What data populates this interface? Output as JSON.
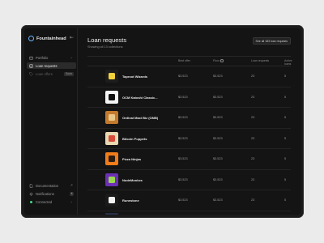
{
  "app": {
    "brand": "Fountainhead"
  },
  "sidebar": {
    "top_items": [
      {
        "label": "Portfolio",
        "icon": "portfolio-icon"
      },
      {
        "label": "Loan requests",
        "icon": "loan-requests-icon",
        "active": true
      },
      {
        "label": "Loan offers",
        "icon": "tag-icon",
        "badge": "Soon",
        "disabled": true
      }
    ],
    "bottom_items": [
      {
        "label": "Documentation",
        "icon": "document-icon"
      },
      {
        "label": "Notifications",
        "icon": "bell-icon",
        "badge": "4"
      },
      {
        "label": "Connected",
        "icon": "status-dot"
      }
    ]
  },
  "main": {
    "title": "Loan requests",
    "subtitle": "Showing all 13 collections",
    "see_all_label": "See all 183 loan requests",
    "columns": [
      "Best offer",
      "Floor",
      "Loan requests",
      "Active loans"
    ],
    "rows": [
      {
        "name": "Taproot Wizards",
        "best_offer": "$3.523",
        "floor": "$3.523",
        "loan_requests": "23",
        "active_loans": "5",
        "thumb_bg": "#1d1d1d",
        "thumb_accent": "#f2d23a"
      },
      {
        "name": "OCM Katoshi Classic...",
        "best_offer": "$3.523",
        "floor": "$3.523",
        "loan_requests": "23",
        "active_loans": "5",
        "thumb_bg": "#f4f4f4",
        "thumb_accent": "#111111"
      },
      {
        "name": "Ordinal Maxi Biz (OMB)",
        "best_offer": "$3.523",
        "floor": "$3.523",
        "loan_requests": "23",
        "active_loans": "5",
        "thumb_bg": "#c47a2c",
        "thumb_accent": "#e9c98a"
      },
      {
        "name": "Bitcoin Puppets",
        "best_offer": "$3.523",
        "floor": "$3.523",
        "loan_requests": "23",
        "active_loans": "5",
        "thumb_bg": "#e9d8b2",
        "thumb_accent": "#d64b3a"
      },
      {
        "name": "Pizza Ninjas",
        "best_offer": "$3.523",
        "floor": "$3.523",
        "loan_requests": "23",
        "active_loans": "5",
        "thumb_bg": "#f07c1a",
        "thumb_accent": "#2b1d12"
      },
      {
        "name": "NodeMonkes",
        "best_offer": "$3.523",
        "floor": "$3.523",
        "loan_requests": "23",
        "active_loans": "5",
        "thumb_bg": "#6c2fb5",
        "thumb_accent": "#9ad64e"
      },
      {
        "name": "Runestone",
        "best_offer": "$3.523",
        "floor": "$3.523",
        "loan_requests": "23",
        "active_loans": "5",
        "thumb_bg": "#1a1a1a",
        "thumb_accent": "#f2f2f2"
      }
    ]
  },
  "colors": {
    "accent": "#6fb2ff",
    "connected": "#3ddc84"
  }
}
